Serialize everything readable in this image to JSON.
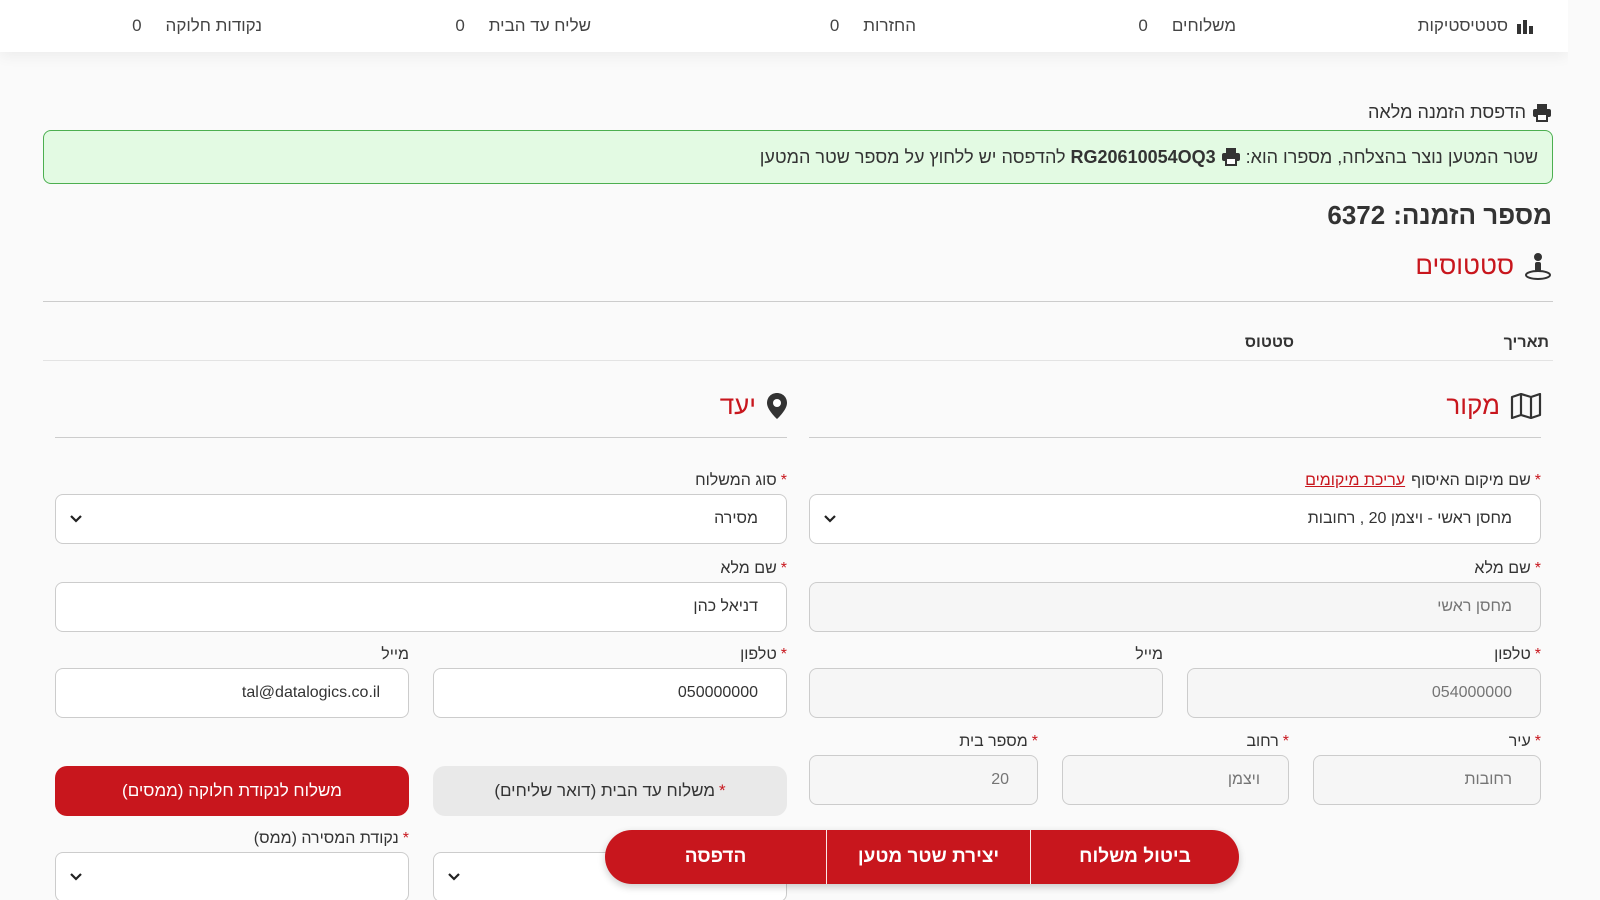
{
  "topbar": {
    "statistics_label": "סטטיסטיקות",
    "shipments_label": "משלוחים",
    "shipments_count": "0",
    "returns_label": "החזרות",
    "returns_count": "0",
    "home_courier_label": "שליח עד הבית",
    "home_courier_count": "0",
    "pickup_points_label": "נקודות חלוקה",
    "pickup_points_count": "0"
  },
  "print_full_label": "הדפסת הזמנה מלאה",
  "alert": {
    "text_before": "שטר המטען נוצר בהצלחה, מספרו הוא:",
    "waybill_number": "RG20610054OQ3",
    "text_after": "להדפסה יש ללחוץ על מספר שטר המטען"
  },
  "order": {
    "label": "מספר הזמנה:",
    "number": "6372"
  },
  "statuses": {
    "title": "סטטוסים",
    "col_date": "תאריך",
    "col_status": "סטטוס"
  },
  "source": {
    "title": "מקור",
    "pickup_location_label": "שם מיקום האיסוף",
    "edit_locations_link": "עריכת מיקומים",
    "pickup_location_value": "מחסן ראשי - ויצמן 20 , רחובות",
    "full_name_label": "שם מלא",
    "full_name_placeholder": "מחסן ראשי",
    "phone_label": "טלפון",
    "phone_placeholder": "054000000",
    "email_label": "מייל",
    "email_value": "",
    "city_label": "עיר",
    "city_placeholder": "רחובות",
    "street_label": "רחוב",
    "street_placeholder": "ויצמן",
    "house_number_label": "מספר בית",
    "house_number_placeholder": "20"
  },
  "destination": {
    "title": "יעד",
    "shipment_type_label": "סוג המשלוח",
    "shipment_type_value": "מסירה",
    "full_name_label": "שם מלא",
    "full_name_value": "דניאל כהן",
    "phone_label": "טלפון",
    "phone_value": "050000000",
    "email_label": "מייל",
    "email_value": "tal@datalogics.co.il",
    "home_delivery_button": "משלוח עד הבית (דואר שליחים)",
    "pickup_point_button": "משלוח לנקודת חלוקה (ממסים)",
    "delivery_point_label": "נקודת המסירה (ממס)"
  },
  "actions": {
    "cancel_label": "ביטול משלוח",
    "create_waybill_label": "יצירת שטר מטען",
    "print_label": "הדפסה"
  },
  "colors": {
    "accent": "#c8161d",
    "success_bg": "#e3fae3",
    "success_border": "#4caf50"
  }
}
